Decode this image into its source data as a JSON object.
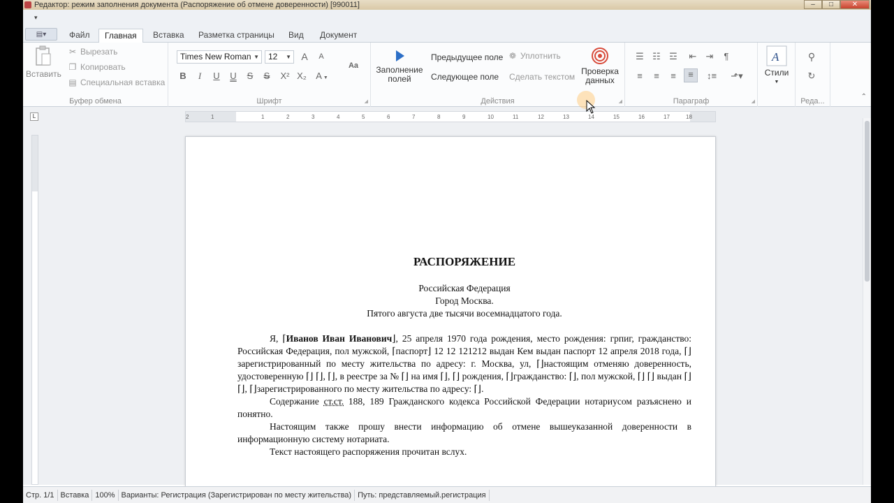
{
  "window": {
    "title": "Редактор: режим заполнения документа (Распоряжение об отмене доверенности) [990011]",
    "controls": {
      "minimize": "–",
      "maximize": "□",
      "close": "✕"
    }
  },
  "tabs": [
    "Файл",
    "Главная",
    "Вставка",
    "Разметка страницы",
    "Вид",
    "Документ"
  ],
  "clipboard": {
    "paste": "Вставить",
    "cut": "Вырезать",
    "copy": "Копировать",
    "paste_special": "Специальная вставка",
    "label": "Буфер обмена"
  },
  "font": {
    "family": "Times New Roman",
    "size": "12",
    "label": "Шрифт",
    "grow": "A",
    "shrink": "A",
    "case": "Aa",
    "bold": "B",
    "italic": "I",
    "underline": "U",
    "double_underline": "U",
    "strike": "S",
    "double_strike": "S",
    "superscript": "X²",
    "subscript": "X₂",
    "color": "A"
  },
  "actions": {
    "fill_fields": "Заполнение полей",
    "prev_field": "Предыдущее поле",
    "next_field": "Следующее поле",
    "compact": "Уплотнить",
    "make_text": "Сделать текстом",
    "check_data": "Проверка данных",
    "label": "Действия"
  },
  "paragraph": {
    "label": "Параграф"
  },
  "styles": {
    "label": "Стили"
  },
  "editing": {
    "label": "Реда..."
  },
  "ruler": {
    "corner": "L",
    "ticks": [
      "2",
      "1",
      "1",
      "2",
      "3",
      "4",
      "5",
      "6",
      "7",
      "8",
      "9",
      "10",
      "11",
      "12",
      "13",
      "14",
      "15",
      "16",
      "17",
      "18"
    ]
  },
  "document": {
    "title": "РАСПОРЯЖЕНИЕ",
    "line1": "Российская Федерация",
    "line2": "Город Москва.",
    "line3": "Пятого августа две тысячи восемнадцатого года.",
    "p1_a": "Я, ⌈",
    "p1_name": "Иванов Иван Иванович",
    "p1_b": "⌋, 25 апреля 1970 года рождения, место рождения: грпиг, гражданство: Российская Федерация, пол мужской, ⌈паспорт⌋ 12 12 121212 выдан Кем выдан паспорт 12 апреля 2018 года, ⌈⌋зарегистрированный по месту жительства по адресу: г. Москва, ул, ⌈⌋настоящим отменяю доверенность, удостоверенную ⌈⌋ ⌈⌋, ⌈⌋, в реестре за № ⌈⌋ на имя ⌈⌋, ⌈⌋ рождения, ⌈⌋гражданство: ⌈⌋, пол мужской, ⌈⌋ ⌈⌋ выдан ⌈⌋ ⌈⌋, ⌈⌋зарегистрированного по месту жительства по адресу: ⌈⌋.",
    "p2_a": "Содержание ",
    "p2_link": "ст.ст.",
    "p2_b": " 188, 189 Гражданского кодекса Российской Федерации нотариусом разъяснено и понятно.",
    "p3": "Настоящим также прошу внести информацию об отмене вышеуказанной доверенности в информационную систему нотариата.",
    "p4": "Текст настоящего распоряжения прочитан вслух."
  },
  "status": {
    "page": "Стр. 1/1",
    "mode": "Вставка",
    "zoom": "100%",
    "variants": "Варианты: Регистрация (Зарегистрирован по месту жительства)",
    "path": "Путь: представляемый.регистрация"
  }
}
